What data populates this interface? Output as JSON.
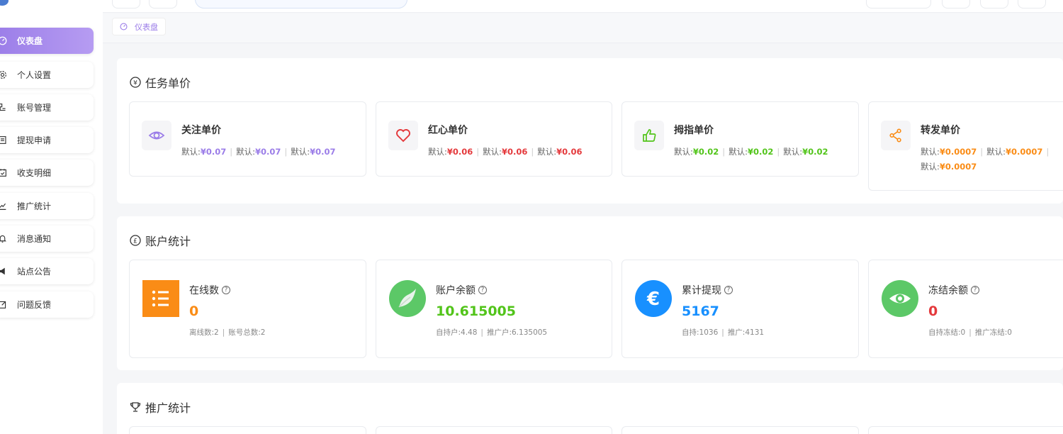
{
  "colors": {
    "accent": "#9b7de8",
    "purple": "#9b7de8",
    "red": "#e4393c",
    "green": "#52c41a",
    "orange": "#fa8c16",
    "blue": "#1890ff"
  },
  "sidebar": {
    "items": [
      {
        "label": "仪表盘",
        "icon": "dashboard-icon"
      },
      {
        "label": "个人设置",
        "icon": "gear-icon"
      },
      {
        "label": "账号管理",
        "icon": "users-icon"
      },
      {
        "label": "提现申请",
        "icon": "withdraw-icon"
      },
      {
        "label": "收支明细",
        "icon": "calendar-icon"
      },
      {
        "label": "推广统计",
        "icon": "chart-icon"
      },
      {
        "label": "消息通知",
        "icon": "bell-icon"
      },
      {
        "label": "站点公告",
        "icon": "megaphone-icon"
      },
      {
        "label": "问题反馈",
        "icon": "edit-icon"
      }
    ]
  },
  "breadcrumb": {
    "label": "仪表盘"
  },
  "task_prices": {
    "title": "任务单价",
    "cards": [
      {
        "title": "关注单价",
        "icon": "eye-icon",
        "prefix": "默认:",
        "values": [
          "¥0.07",
          "¥0.07",
          "¥0.07"
        ]
      },
      {
        "title": "红心单价",
        "icon": "heart-icon",
        "prefix": "默认:",
        "values": [
          "¥0.06",
          "¥0.06",
          "¥0.06"
        ]
      },
      {
        "title": "拇指单价",
        "icon": "thumbs-up-icon",
        "prefix": "默认:",
        "values": [
          "¥0.02",
          "¥0.02",
          "¥0.02"
        ]
      },
      {
        "title": "转发单价",
        "icon": "share-icon",
        "prefix": "默认:",
        "values": [
          "¥0.0007",
          "¥0.0007",
          "¥0.0007"
        ]
      }
    ]
  },
  "account_stats": {
    "title": "账户统计",
    "cards": [
      {
        "title": "在线数",
        "value": "0",
        "sub": [
          "离线数:2",
          "账号总数:2"
        ],
        "icon": "list-icon"
      },
      {
        "title": "账户余额",
        "value": "10.615005",
        "sub": [
          "自持户:4.48",
          "推广户:6.135005"
        ],
        "icon": "bird-icon"
      },
      {
        "title": "累计提现",
        "value": "5167",
        "sub": [
          "自持:1036",
          "推广:4131"
        ],
        "icon": "euro-icon"
      },
      {
        "title": "冻结余额",
        "value": "0",
        "sub": [
          "自持冻结:0",
          "推广冻结:0"
        ],
        "icon": "eye-icon"
      }
    ]
  },
  "promo_stats": {
    "title": "推广统计"
  }
}
